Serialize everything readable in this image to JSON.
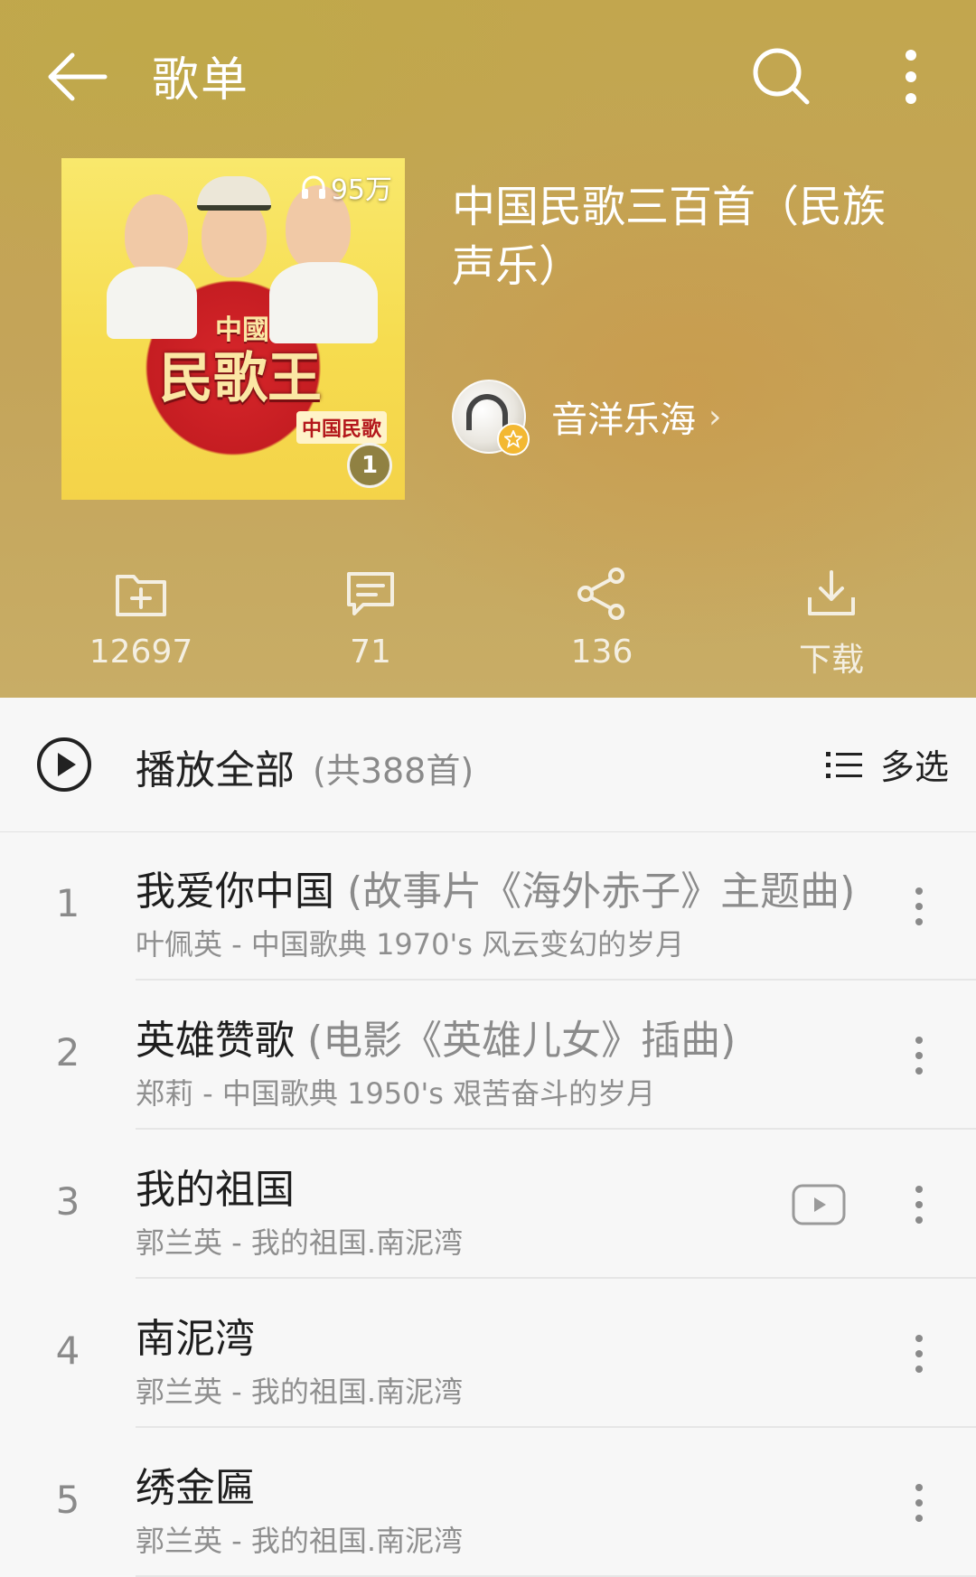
{
  "topbar": {
    "title": "歌单",
    "back_icon": "arrow-left-icon",
    "search_icon": "search-icon",
    "more_icon": "more-vertical-icon"
  },
  "playlist": {
    "cover": {
      "play_count": "95万",
      "album_title": "民歌王",
      "album_subtitle": "中國",
      "stamp": "中国民歌",
      "badge": "1"
    },
    "title": "中国民歌三百首（民族声乐）",
    "creator": {
      "name": "音洋乐海",
      "chevron": "›"
    }
  },
  "actions": {
    "collect": {
      "icon": "folder-add-icon",
      "label": "12697"
    },
    "comment": {
      "icon": "comment-icon",
      "label": "71"
    },
    "share": {
      "icon": "share-icon",
      "label": "136"
    },
    "download": {
      "icon": "download-icon",
      "label": "下载"
    }
  },
  "play_all": {
    "label": "播放全部",
    "count": "(共388首)",
    "multi_select": "多选"
  },
  "songs": [
    {
      "index": "1",
      "title": "我爱你中国",
      "note": " (故事片《海外赤子》主题曲)",
      "subtitle": "叶佩英 - 中国歌典  1970's 风云变幻的岁月",
      "has_mv": false
    },
    {
      "index": "2",
      "title": "英雄赞歌",
      "note": " (电影《英雄儿女》插曲)",
      "subtitle": "郑莉 - 中国歌典 1950's 艰苦奋斗的岁月",
      "has_mv": false
    },
    {
      "index": "3",
      "title": "我的祖国",
      "note": "",
      "subtitle": "郭兰英 - 我的祖国.南泥湾",
      "has_mv": true
    },
    {
      "index": "4",
      "title": "南泥湾",
      "note": "",
      "subtitle": "郭兰英 - 我的祖国.南泥湾",
      "has_mv": false
    },
    {
      "index": "5",
      "title": "绣金匾",
      "note": "",
      "subtitle": "郭兰英 - 我的祖国.南泥湾",
      "has_mv": false
    }
  ],
  "colors": {
    "header_gold": "#c4a459",
    "text_dark": "#1e1e1e",
    "text_muted": "#8a8a8a"
  }
}
